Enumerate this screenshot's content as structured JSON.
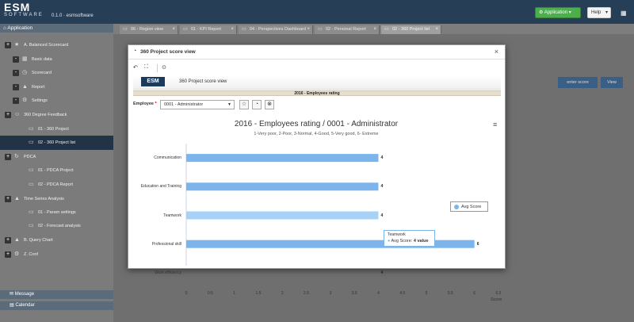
{
  "header": {
    "brand": "ESM",
    "brand_sub": "SOFTWARE",
    "version": "0.1.0 · esmsoftware",
    "application_label": "Application",
    "help_label": "Help"
  },
  "sidebar": {
    "title": "Application",
    "items": [
      {
        "toggle": "+",
        "icon": "star",
        "label": "A. Balanced Scorecard"
      },
      {
        "toggle": "-",
        "icon": "grid",
        "label": "Basic data"
      },
      {
        "toggle": "-",
        "icon": "gauge",
        "label": "Scorecard"
      },
      {
        "toggle": "-",
        "icon": "chart",
        "label": "Report"
      },
      {
        "toggle": "-",
        "icon": "gear",
        "label": "Settings"
      },
      {
        "toggle": "+",
        "icon": "users",
        "label": "360 Degree Feedback"
      },
      {
        "toggle": "",
        "icon": "doc",
        "label": "01 - 360 Project"
      },
      {
        "toggle": "",
        "icon": "doc",
        "label": "02 - 360 Project list"
      },
      {
        "toggle": "+",
        "icon": "refresh",
        "label": "PDCA"
      },
      {
        "toggle": "",
        "icon": "doc",
        "label": "01 - PDCA Project"
      },
      {
        "toggle": "",
        "icon": "doc",
        "label": "02 - PDCA Report"
      },
      {
        "toggle": "+",
        "icon": "chart",
        "label": "Time Series Analysis"
      },
      {
        "toggle": "",
        "icon": "doc",
        "label": "01 - Param settings"
      },
      {
        "toggle": "",
        "icon": "doc",
        "label": "02 - Forecast analysis"
      },
      {
        "toggle": "+",
        "icon": "chart",
        "label": "B. Query Chart"
      },
      {
        "toggle": "+",
        "icon": "gear",
        "label": "Z. Conf"
      }
    ],
    "message_label": "Message",
    "calendar_label": "Calendar"
  },
  "tabs": [
    {
      "label": "06 - Region view"
    },
    {
      "label": "01 - KPI Report"
    },
    {
      "label": "04 - Perspectives Dashboard"
    },
    {
      "label": "02 - Personal Report"
    },
    {
      "label": "02 - 360 Project list"
    }
  ],
  "background": {
    "enter_score": "enter score",
    "view": "View"
  },
  "modal": {
    "title": "360 Project score view",
    "banner_logo": "ESM",
    "banner_title": "360 Project score view",
    "rating_strip": "2016 - Employees rating",
    "employee_label": "Employee",
    "employee_required": "*",
    "employee_value": "0001 - Administrator"
  },
  "chart_data": {
    "type": "bar",
    "title": "2016 - Employees rating / 0001 - Administrator",
    "subtitle": "1-Very poor, 2-Poor, 3-Normal, 4-Good, 5-Very good, 6- Extreme",
    "categories": [
      "Communication",
      "Education and Training",
      "Teamwork",
      "Professional skill",
      "Work efficiency"
    ],
    "series": [
      {
        "name": "Avg Score",
        "values": [
          4,
          4,
          4,
          6,
          4
        ],
        "color": "#7cb5ec"
      }
    ],
    "xlabel": "Score",
    "xlim": [
      0,
      6.5
    ],
    "ticks": [
      "0",
      "0.5",
      "1",
      "1.5",
      "2",
      "2.5",
      "3",
      "3.5",
      "4",
      "4.5",
      "5",
      "5.5",
      "6",
      "6.5"
    ],
    "highlight_index": 2,
    "highlight_color": "#a8d1f7",
    "legend": "right",
    "tooltip": {
      "category": "Teamwork",
      "series": "Avg Score",
      "value_text": "4 value"
    }
  }
}
